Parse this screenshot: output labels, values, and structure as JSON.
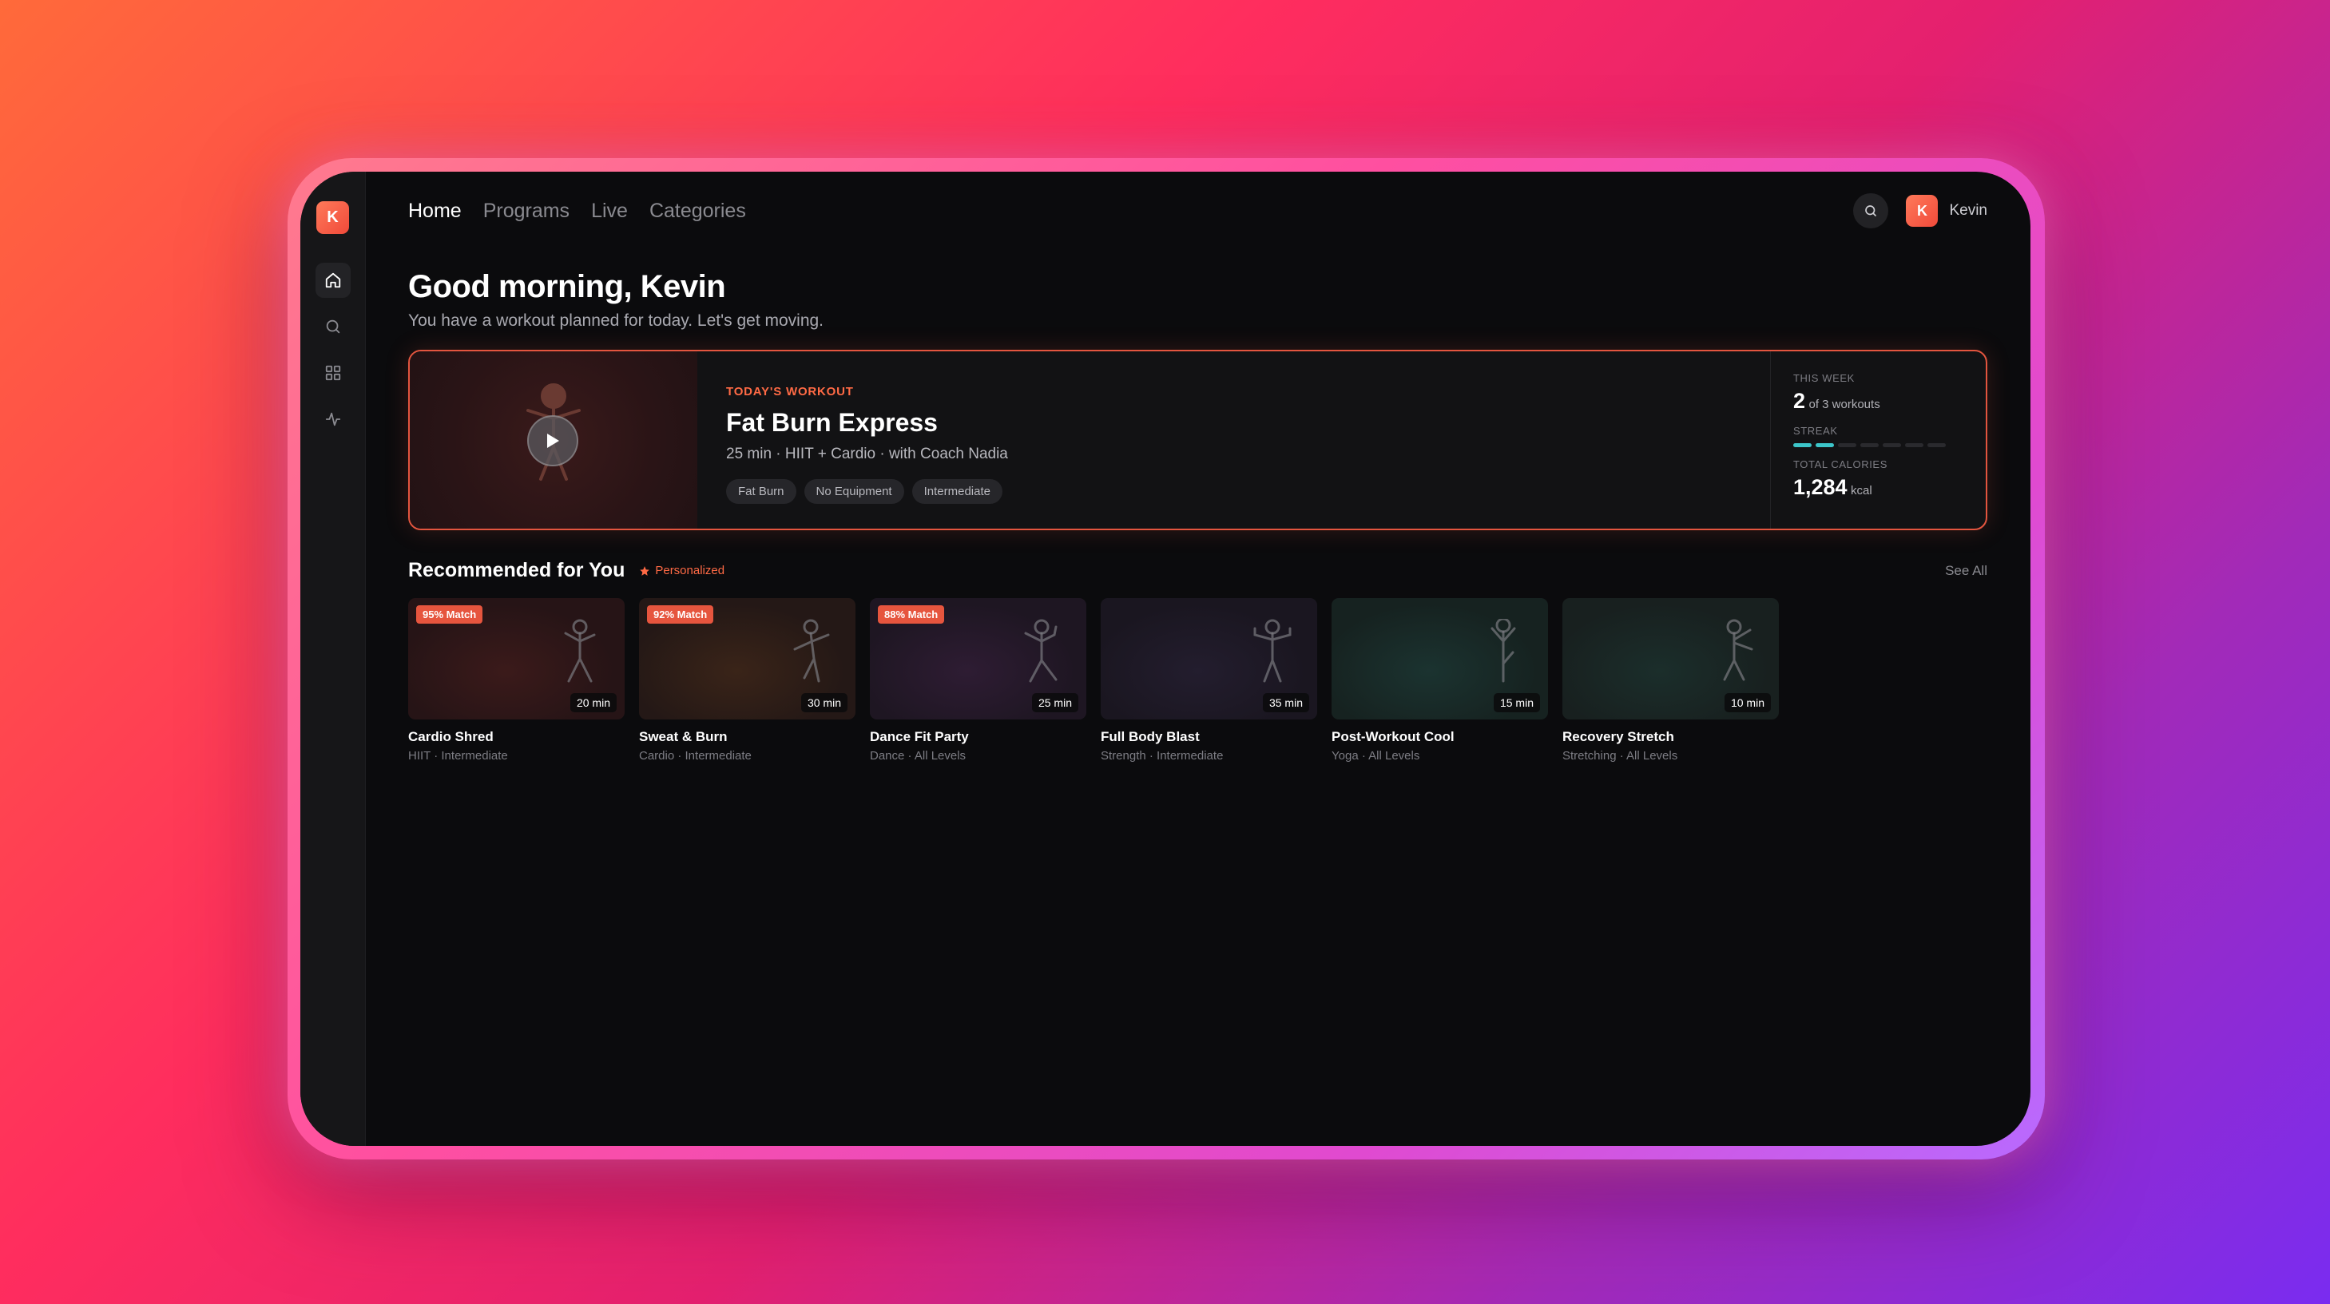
{
  "app": {
    "logo_letter": "K"
  },
  "sidebar": {
    "items": [
      {
        "icon": "home-icon",
        "active": true
      },
      {
        "icon": "search-icon",
        "active": false
      },
      {
        "icon": "grid-icon",
        "active": false
      },
      {
        "icon": "activity-icon",
        "active": false
      }
    ]
  },
  "nav": {
    "tabs": [
      {
        "label": "Home"
      },
      {
        "label": "Programs"
      },
      {
        "label": "Live"
      },
      {
        "label": "Categories"
      }
    ]
  },
  "user": {
    "initial": "K",
    "name": "Kevin"
  },
  "greeting": {
    "title": "Good morning, Kevin",
    "subtitle": "You have a workout planned for today. Let's get moving."
  },
  "hero": {
    "label": "TODAY'S WORKOUT",
    "title": "Fat Burn Express",
    "meta": "25 min · HIIT + Cardio · with Coach Nadia",
    "tags": [
      "Fat Burn",
      "No Equipment",
      "Intermediate"
    ]
  },
  "stats": {
    "week_label": "THIS WEEK",
    "week_value": "2",
    "week_suffix": "of 3 workouts",
    "streak_label": "STREAK",
    "streak_days_on": 2,
    "streak_days_total": 7,
    "calories_label": "TOTAL CALORIES",
    "calories_value": "1,284",
    "calories_unit": "kcal"
  },
  "recommended": {
    "title": "Recommended for You",
    "personalized": "Personalized",
    "see_all": "See All",
    "cards": [
      {
        "badge": "95% Match",
        "duration": "20 min",
        "title": "Cardio Shred",
        "sub": "HIIT · Intermediate",
        "colors": [
          "#3b1a1a",
          "#261416"
        ]
      },
      {
        "badge": "92% Match",
        "duration": "30 min",
        "title": "Sweat & Burn",
        "sub": "Cardio · Intermediate",
        "colors": [
          "#3a2418",
          "#241816"
        ]
      },
      {
        "badge": "88% Match",
        "duration": "25 min",
        "title": "Dance Fit Party",
        "sub": "Dance · All Levels",
        "colors": [
          "#2e1c33",
          "#1e1622"
        ]
      },
      {
        "badge": "",
        "duration": "35 min",
        "title": "Full Body Blast",
        "sub": "Strength · Intermediate",
        "colors": [
          "#231d2e",
          "#1a1620"
        ]
      },
      {
        "badge": "",
        "duration": "15 min",
        "title": "Post-Workout Cool",
        "sub": "Yoga · All Levels",
        "colors": [
          "#1b3330",
          "#162220"
        ]
      },
      {
        "badge": "",
        "duration": "10 min",
        "title": "Recovery Stretch",
        "sub": "Stretching · All Levels",
        "colors": [
          "#1b2e2b",
          "#18201f"
        ]
      }
    ]
  },
  "colors": {
    "accent": "#e6553e",
    "streak": "#3cc5c9"
  }
}
